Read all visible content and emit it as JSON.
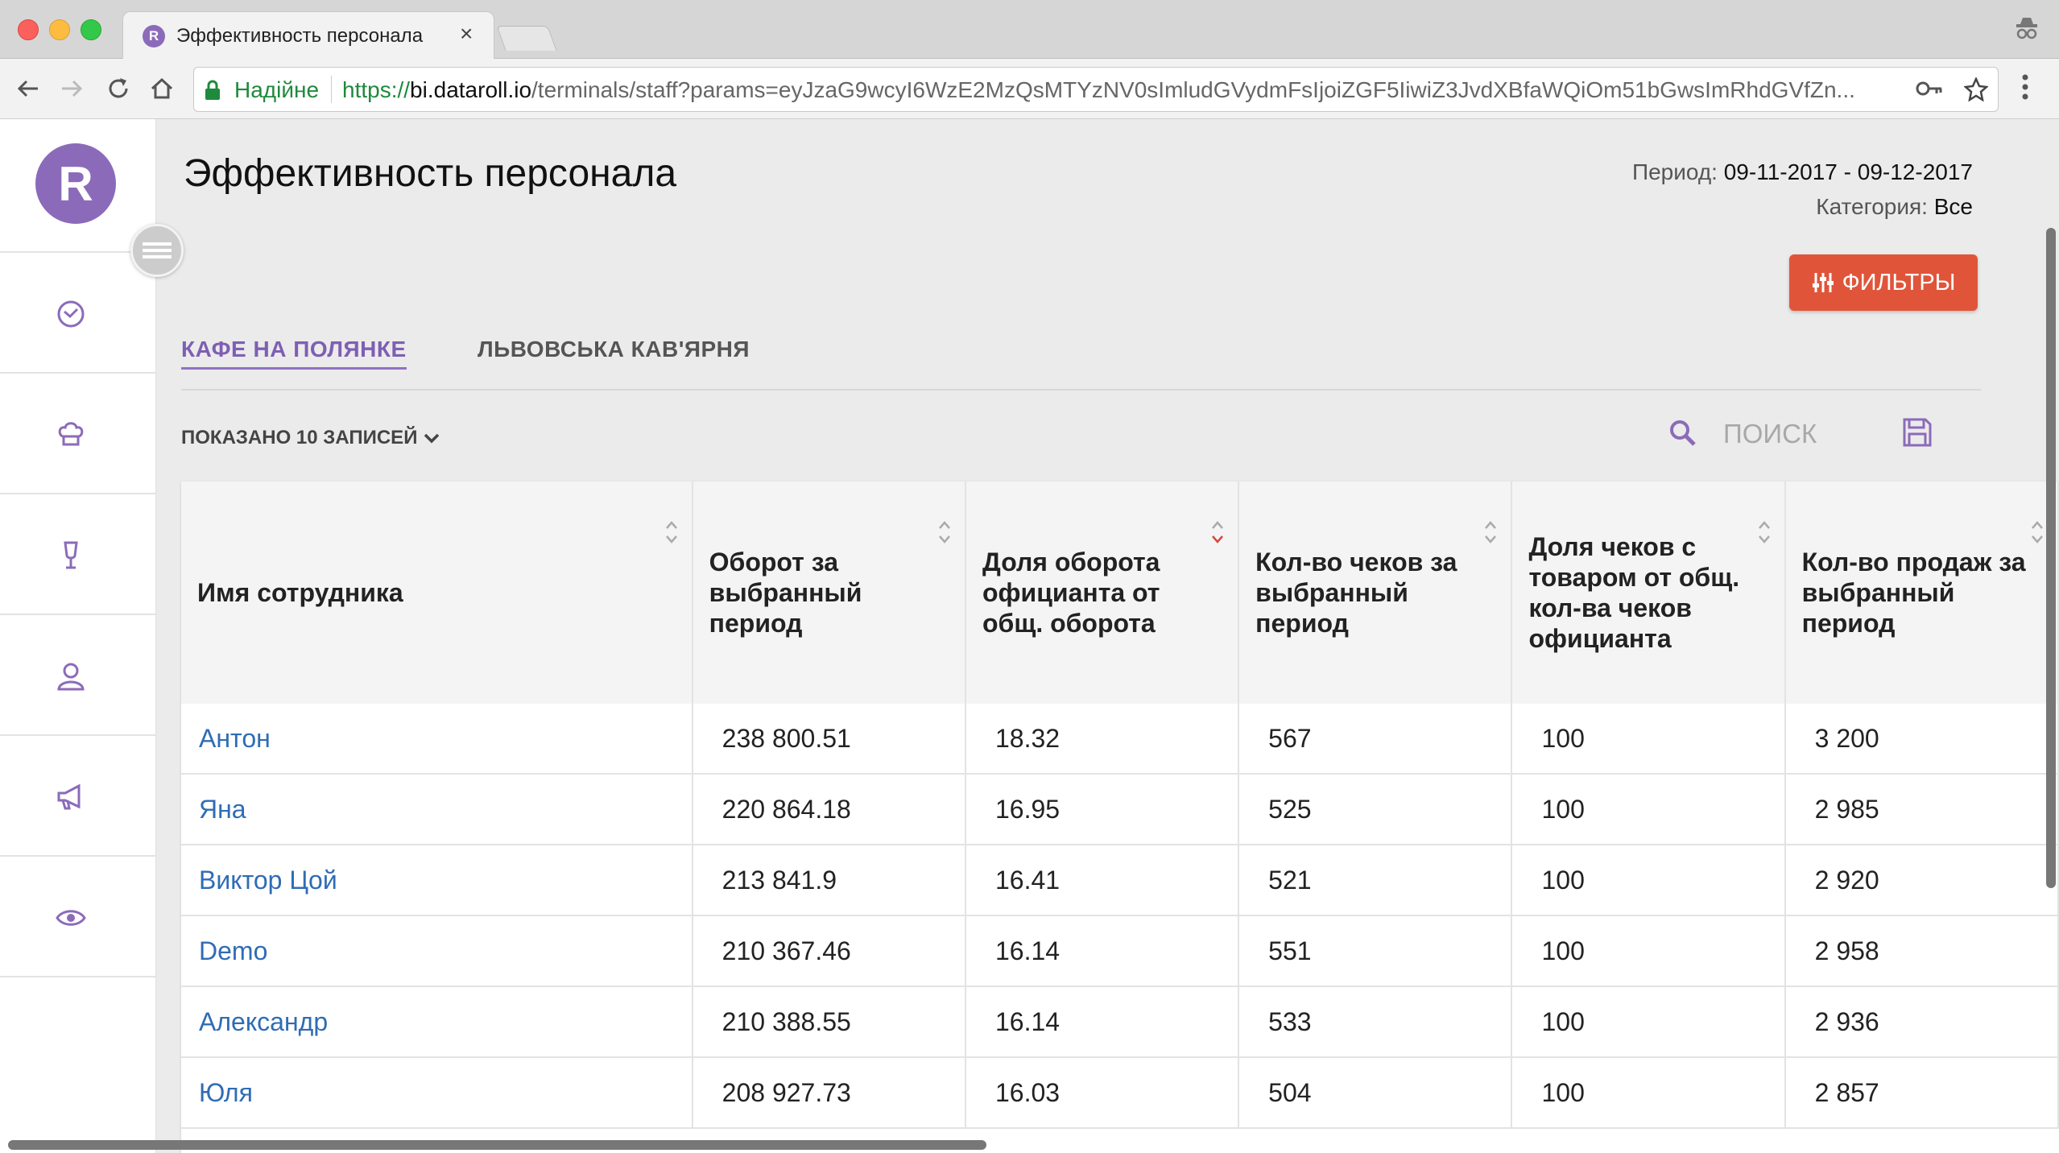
{
  "browser": {
    "tab_title": "Эффективность персонала",
    "tab_close": "×",
    "favicon_letter": "R",
    "secure_label": "Надійне",
    "url_protocol": "https://",
    "url_host": "bi.dataroll.io",
    "url_path": "/terminals/staff?params=eyJzaG9wcyI6WzE2MzQsMTYzNV0sImludGVydmFsIjoiZGF5IiwiZ3JvdXBfaWQiOm51bGwsImRhdGVfZn..."
  },
  "app": {
    "logo_letter": "R",
    "page_title": "Эффективность персонала",
    "period_label": "Период:",
    "period_value": "09-11-2017 - 09-12-2017",
    "category_label": "Категория:",
    "category_value": "Все",
    "filters_label": "ФИЛЬТРЫ",
    "tabs": [
      {
        "label": "КАФЕ НА ПОЛЯНКЕ"
      },
      {
        "label": "ЛЬВОВСЬКА КАВ'ЯРНЯ"
      }
    ],
    "shown_label": "ПОКАЗАНО 10 ЗАПИСЕЙ",
    "search_placeholder": "ПОИСК"
  },
  "table": {
    "columns": [
      "Имя сотрудника",
      "Оборот за выбранный период",
      "Доля оборота официанта от общ. оборота",
      "Кол-во чеков за выбранный период",
      "Доля чеков с товаром от общ. кол-ва чеков официанта",
      "Кол-во продаж за выбранный период"
    ],
    "rows": [
      [
        "Антон",
        "238 800.51",
        "18.32",
        "567",
        "100",
        "3 200"
      ],
      [
        "Яна",
        "220 864.18",
        "16.95",
        "525",
        "100",
        "2 985"
      ],
      [
        "Виктор Цой",
        "213 841.9",
        "16.41",
        "521",
        "100",
        "2 920"
      ],
      [
        "Demo",
        "210 367.46",
        "16.14",
        "551",
        "100",
        "2 958"
      ],
      [
        "Александр",
        "210 388.55",
        "16.14",
        "533",
        "100",
        "2 936"
      ],
      [
        "Юля",
        "208 927.73",
        "16.03",
        "504",
        "100",
        "2 857"
      ]
    ]
  },
  "colors": {
    "accent": "#8b6bb9",
    "filters_button": "#e0553a",
    "link": "#2f6cb5",
    "active_sort": "#d9463a"
  },
  "icons": {
    "sidebar": [
      "dashboard-icon",
      "chef-hat-icon",
      "glass-icon",
      "user-icon",
      "megaphone-icon",
      "eye-icon"
    ]
  }
}
